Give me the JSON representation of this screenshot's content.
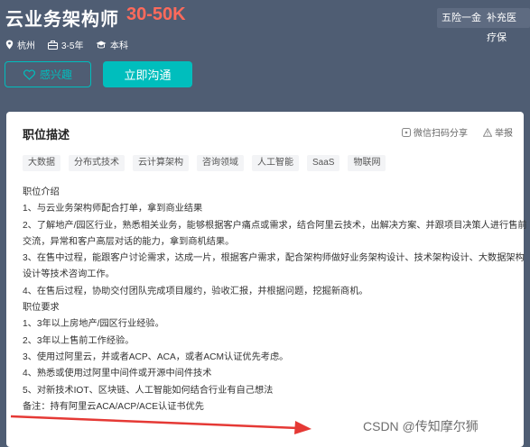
{
  "job": {
    "title": "云业务架构师",
    "salary": "30-50K",
    "tags": [
      "五险一金",
      "补充医疗保"
    ],
    "location": "杭州",
    "experience": "3-5年",
    "education": "本科"
  },
  "actions": {
    "like_label": "感兴趣",
    "chat_label": "立即沟通"
  },
  "card": {
    "title": "职位描述",
    "share_label": "微信扫码分享",
    "report_label": "举报",
    "skills": [
      "大数据",
      "分布式技术",
      "云计算架构",
      "咨询领域",
      "人工智能",
      "SaaS",
      "物联网"
    ],
    "lines": [
      "职位介绍",
      "1、与云业务架构师配合打单，拿到商业结果",
      "2、了解地产/园区行业，熟悉相关业务，能够根据客户痛点或需求，结合阿里云技术，出解决方案、并跟项目决策人进行售前",
      "交流，异常和客户高层对话的能力，拿到商机结果。",
      "3、在售中过程，能跟客户讨论需求，达成一片，根据客户需求，配合架构师做好业务架构设计、技术架构设计、大数据架构",
      "设计等技术咨询工作。",
      "4、在售后过程，协助交付团队完成项目履约，验收汇报，并根据问题，挖掘新商机。",
      "职位要求",
      "1、3年以上房地产/园区行业经验。",
      "2、3年以上售前工作经验。",
      "3、使用过阿里云，并或者ACP、ACA，或者ACM认证优先考虑。",
      "4、熟悉或使用过阿里中间件或开源中间件技术",
      "5、对新技术IOT、区块链、人工智能如何结合行业有自己想法",
      "备注：持有阿里云ACA/ACP/ACE认证书优先"
    ]
  },
  "watermark": "CSDN @传知摩尔狮",
  "colors": {
    "header_bg": "#4f5d73",
    "accent": "#00bebd",
    "salary": "#ff6a5b",
    "arrow": "#e53935"
  }
}
